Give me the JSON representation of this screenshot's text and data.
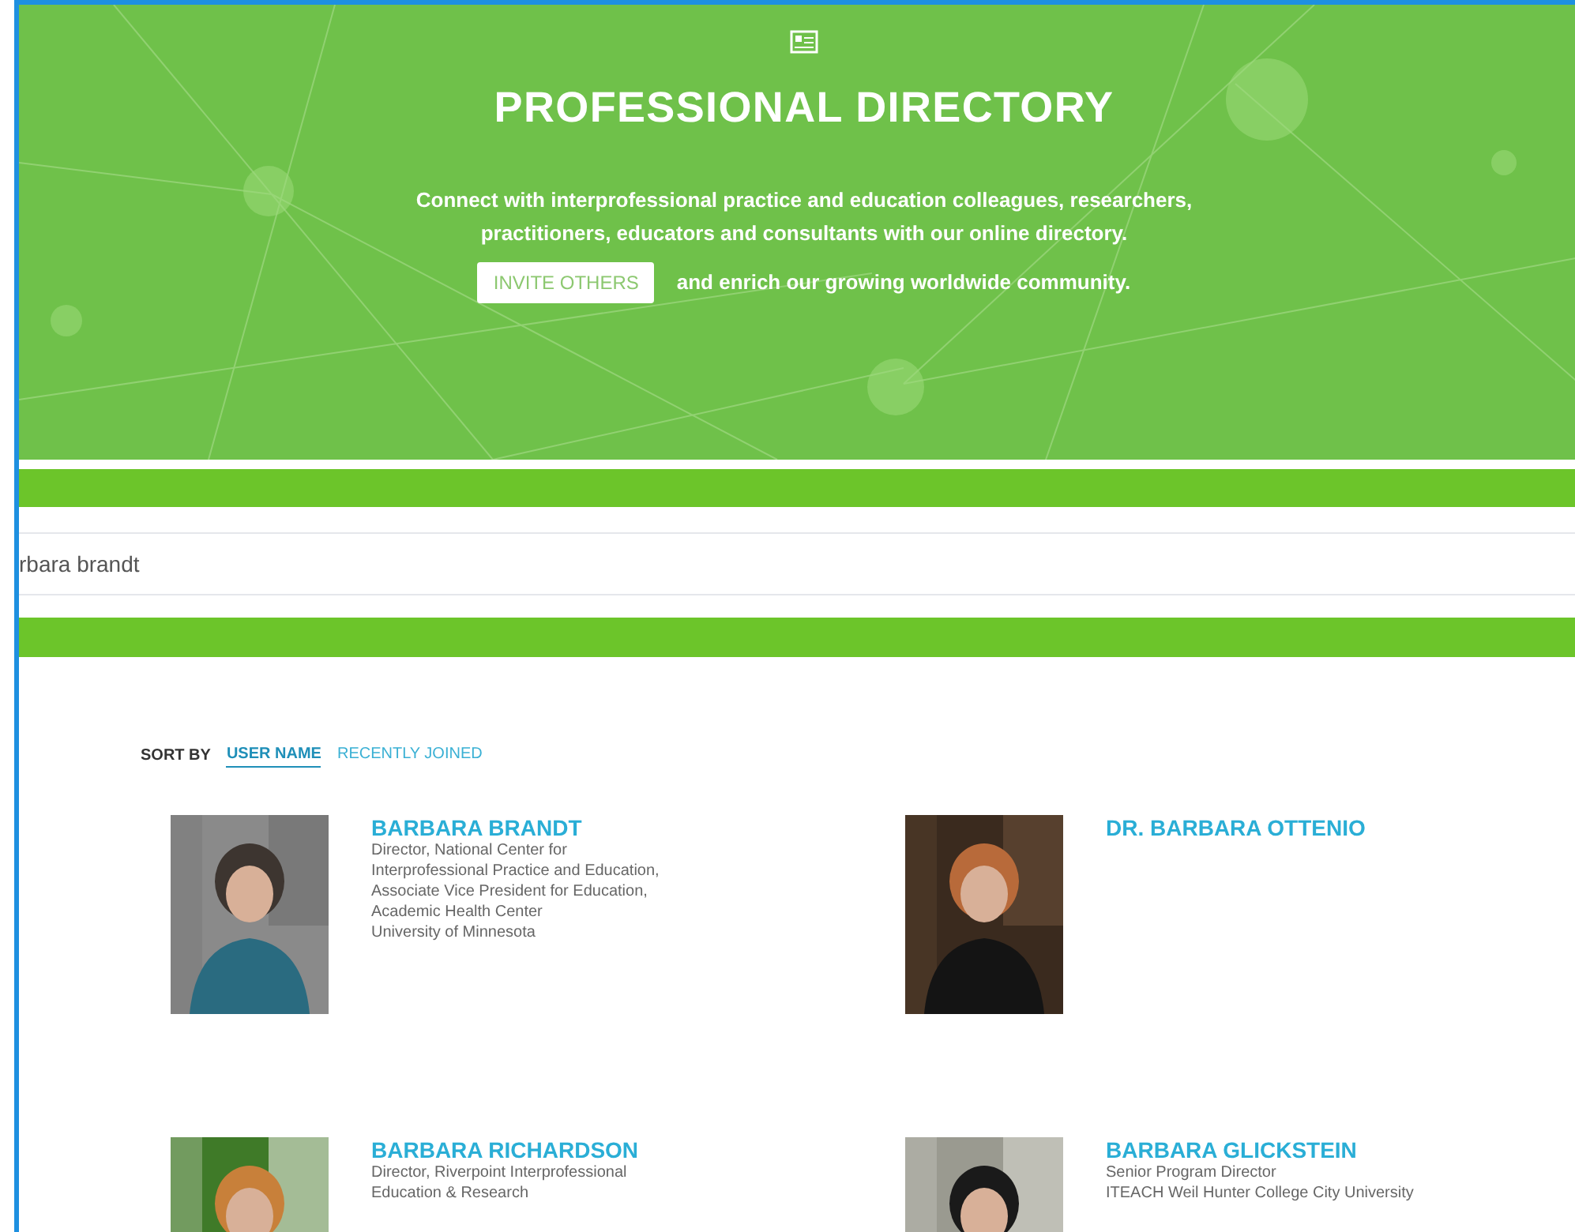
{
  "header": {
    "title": "PROFESSIONAL DIRECTORY",
    "description": "Connect with interprofessional practice and education colleagues, researchers, practitioners, educators and consultants with our online directory.",
    "invite_button": "INVITE OTHERS",
    "invite_text": "and enrich our growing worldwide community."
  },
  "search": {
    "value": "rbara brandt"
  },
  "sort": {
    "label": "SORT BY",
    "options": [
      {
        "label": "USER NAME",
        "selected": true
      },
      {
        "label": "RECENTLY JOINED",
        "selected": false
      }
    ]
  },
  "members": [
    {
      "name": "BARBARA BRANDT",
      "details": [
        "Director, National Center for",
        "Interprofessional Practice and Education,",
        "Associate Vice President for Education,",
        "Academic Health Center",
        "University of Minnesota"
      ]
    },
    {
      "name": "DR. BARBARA OTTENIO"
    },
    {
      "name": "BARBARA RICHARDSON",
      "details": [
        "Director, Riverpoint Interprofessional",
        "Education & Research"
      ]
    },
    {
      "name": "BARBARA GLICKSTEIN",
      "details": [
        "Senior Program Director",
        "ITEACH Weil Hunter College City University"
      ]
    }
  ]
}
